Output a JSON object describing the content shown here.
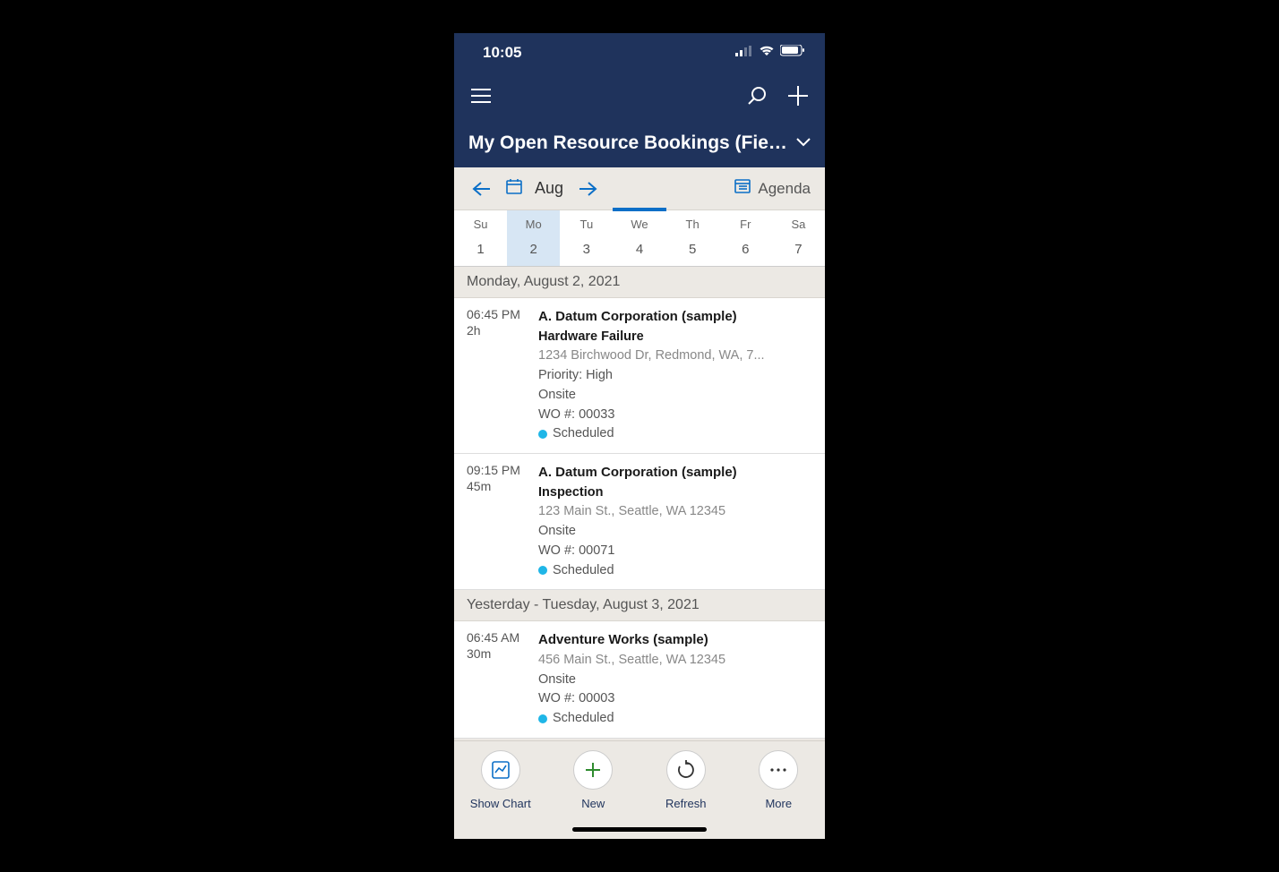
{
  "status": {
    "time": "10:05"
  },
  "title": "My Open Resource Bookings (Fiel...",
  "month": {
    "label": "Aug",
    "view": "Agenda"
  },
  "week": {
    "days": [
      {
        "name": "Su",
        "num": "1",
        "sel": false,
        "today": false
      },
      {
        "name": "Mo",
        "num": "2",
        "sel": true,
        "today": false
      },
      {
        "name": "Tu",
        "num": "3",
        "sel": false,
        "today": false
      },
      {
        "name": "We",
        "num": "4",
        "sel": false,
        "today": true
      },
      {
        "name": "Th",
        "num": "5",
        "sel": false,
        "today": false
      },
      {
        "name": "Fr",
        "num": "6",
        "sel": false,
        "today": false
      },
      {
        "name": "Sa",
        "num": "7",
        "sel": false,
        "today": false
      }
    ]
  },
  "sections": [
    {
      "header": "Monday, August 2, 2021",
      "cards": [
        {
          "time": "06:45 PM",
          "dur": "2h",
          "title": "A. Datum Corporation (sample)",
          "sub": "Hardware Failure",
          "addr": "1234 Birchwood Dr, Redmond, WA, 7...",
          "priority": "Priority: High",
          "loc": "Onsite",
          "wo": "WO #: 00033",
          "status": "Scheduled"
        },
        {
          "time": "09:15 PM",
          "dur": "45m",
          "title": "A. Datum Corporation (sample)",
          "sub": "Inspection",
          "addr": "123 Main St., Seattle, WA 12345",
          "priority": "",
          "loc": "Onsite",
          "wo": "WO #: 00071",
          "status": "Scheduled"
        }
      ]
    },
    {
      "header": "Yesterday - Tuesday, August 3, 2021",
      "cards": [
        {
          "time": "06:45 AM",
          "dur": "30m",
          "title": "Adventure Works (sample)",
          "sub": "",
          "addr": "456 Main St., Seattle, WA 12345",
          "priority": "",
          "loc": "Onsite",
          "wo": "WO #: 00003",
          "status": "Scheduled"
        }
      ]
    }
  ],
  "bottom": {
    "showChart": "Show Chart",
    "new": "New",
    "refresh": "Refresh",
    "more": "More"
  }
}
